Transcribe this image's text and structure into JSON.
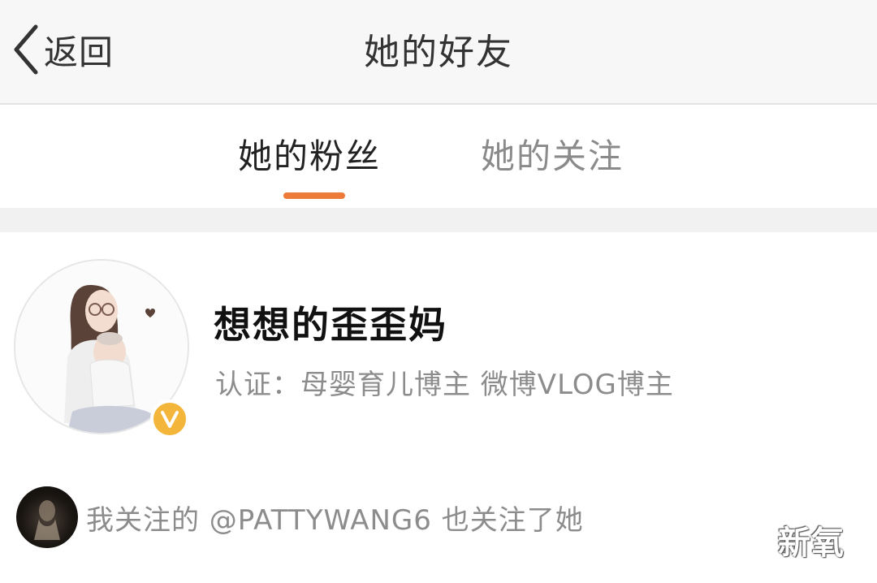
{
  "navbar": {
    "back_label": "返回",
    "title": "她的好友"
  },
  "tabs": {
    "items": [
      {
        "label": "她的粉丝",
        "active": true
      },
      {
        "label": "她的关注",
        "active": false
      }
    ],
    "accent_color": "#ee7a3a"
  },
  "user": {
    "name": "想想的歪歪妈",
    "verification": "认证：母婴育儿博主 微博VLOG博主",
    "badge_icon": "verified-v-icon",
    "badge_color": "#f4b63a",
    "badge_letter": "V"
  },
  "mutual": {
    "text": "我关注的 @PATTYWANG6 也关注了她"
  },
  "watermark": {
    "text": "新氧"
  }
}
